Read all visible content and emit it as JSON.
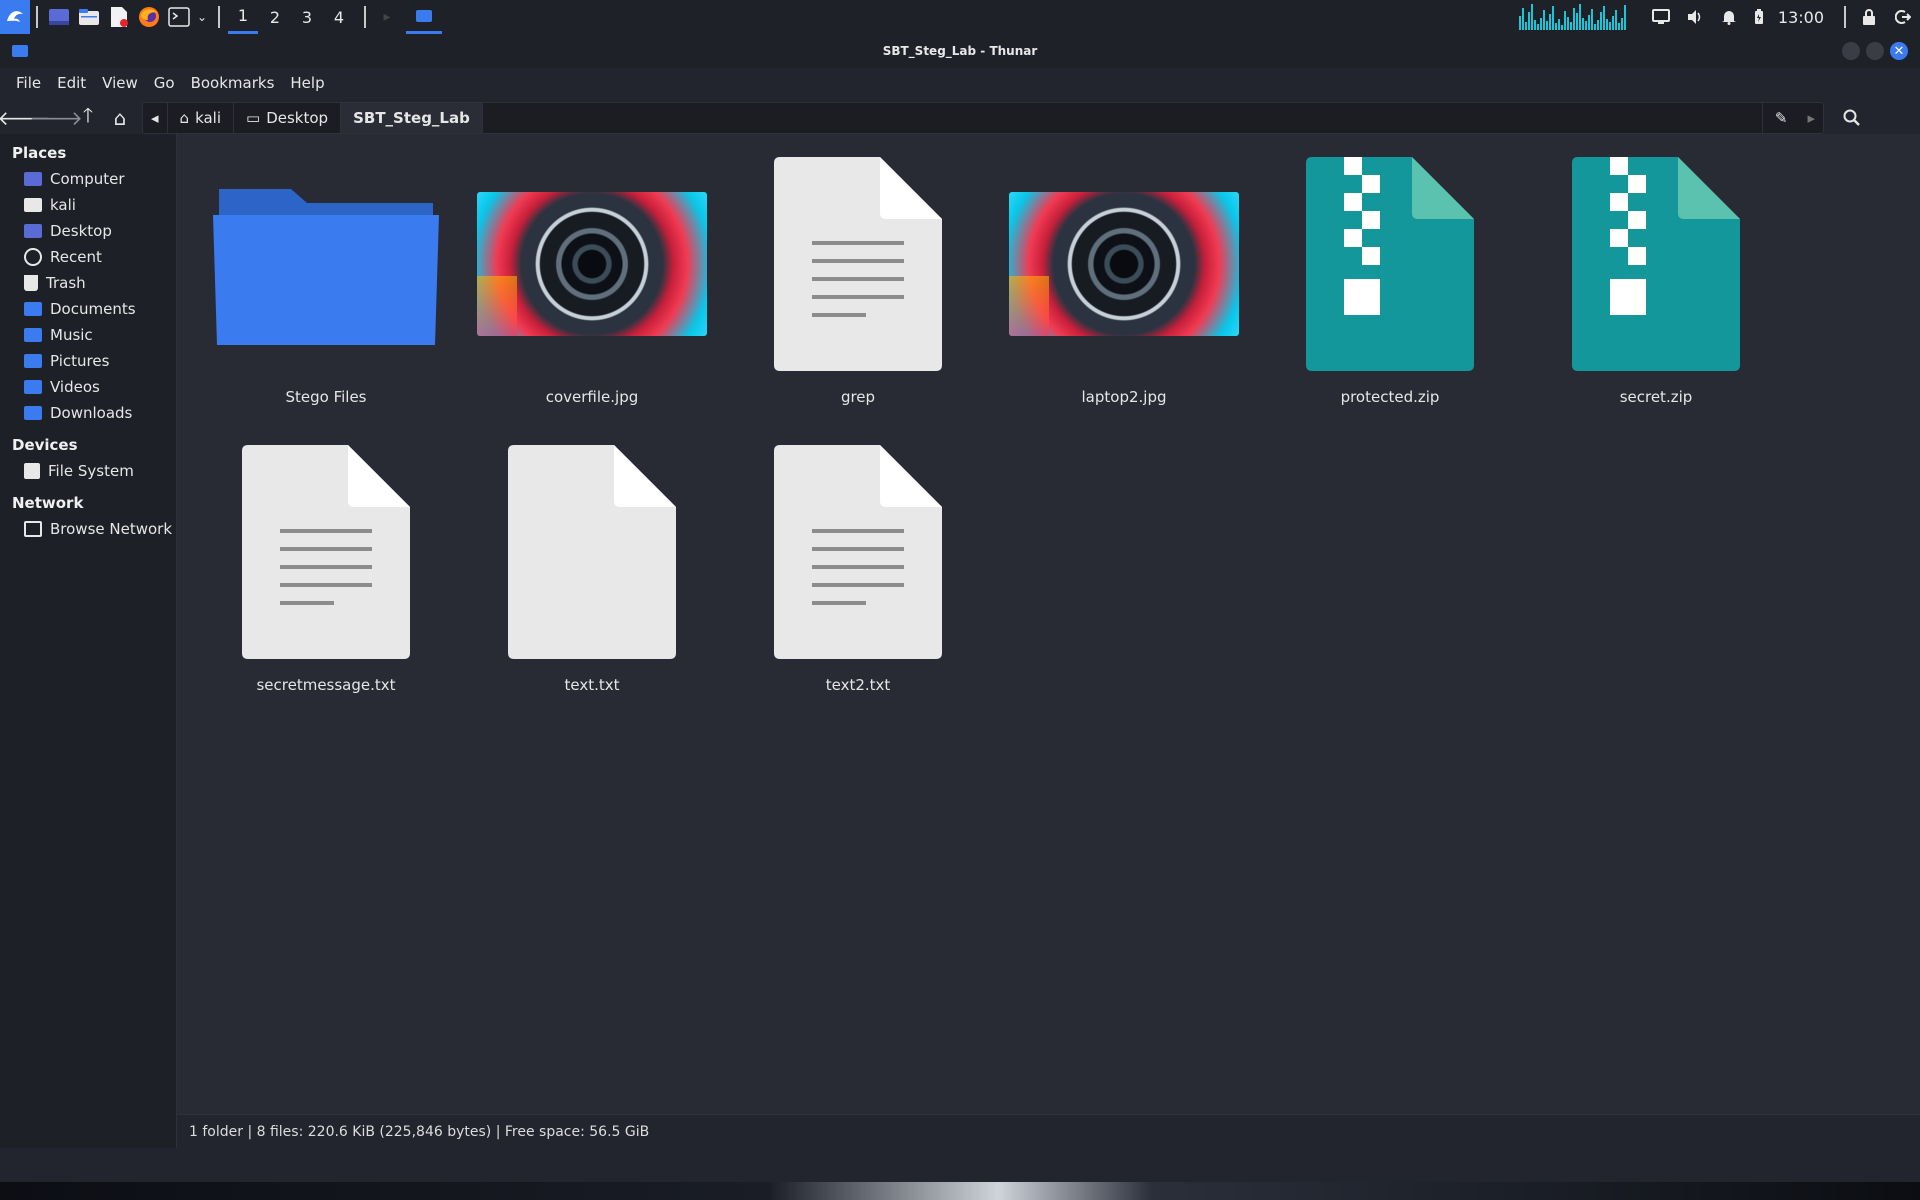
{
  "panel": {
    "workspaces": [
      "1",
      "2",
      "3",
      "4"
    ],
    "clock": "13:00"
  },
  "window": {
    "title": "SBT_Steg_Lab - Thunar"
  },
  "menu": [
    "File",
    "Edit",
    "View",
    "Go",
    "Bookmarks",
    "Help"
  ],
  "path": {
    "crumbs": [
      "kali",
      "Desktop",
      "SBT_Steg_Lab"
    ]
  },
  "sidebar": {
    "places_header": "Places",
    "places": [
      "Computer",
      "kali",
      "Desktop",
      "Recent",
      "Trash",
      "Documents",
      "Music",
      "Pictures",
      "Videos",
      "Downloads"
    ],
    "devices_header": "Devices",
    "devices": [
      "File System"
    ],
    "network_header": "Network",
    "network": [
      "Browse Network"
    ]
  },
  "files": [
    {
      "name": "Stego Files",
      "icon": "folder-icon"
    },
    {
      "name": "coverfile.jpg",
      "icon": "image-thumbnail"
    },
    {
      "name": "grep",
      "icon": "text-file-icon"
    },
    {
      "name": "laptop2.jpg",
      "icon": "image-thumbnail"
    },
    {
      "name": "protected.zip",
      "icon": "zip-file-icon"
    },
    {
      "name": "secret.zip",
      "icon": "zip-file-icon"
    },
    {
      "name": "secretmessage.txt",
      "icon": "text-file-icon"
    },
    {
      "name": "text.txt",
      "icon": "blank-file-icon"
    },
    {
      "name": "text2.txt",
      "icon": "text-file-icon"
    }
  ],
  "status": "1 folder  |  8 files: 220.6 KiB (225,846 bytes)  |  Free space: 56.5 GiB",
  "colors": {
    "accent": "#3b7bf0",
    "zip": "#14979b",
    "background": "#282b33"
  }
}
